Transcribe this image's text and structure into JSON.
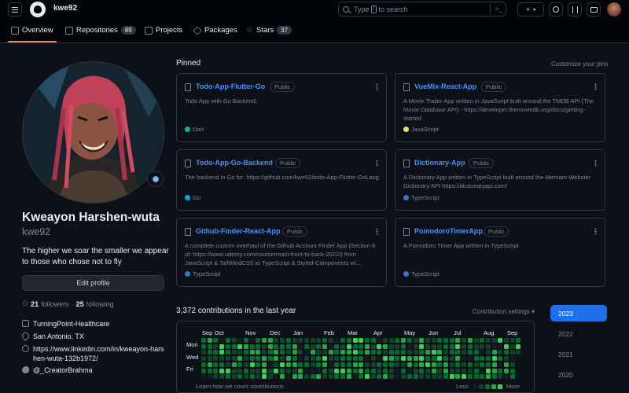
{
  "header": {
    "username": "kwe92",
    "search_prefix": "Type",
    "search_key": "/",
    "search_suffix": "to search",
    "command_glyph": ">_",
    "new_glyph": "+"
  },
  "tabs": [
    {
      "label": "Overview",
      "count": null,
      "active": true
    },
    {
      "label": "Repositories",
      "count": "89"
    },
    {
      "label": "Projects",
      "count": null
    },
    {
      "label": "Packages",
      "count": null
    },
    {
      "label": "Stars",
      "count": "37"
    }
  ],
  "profile": {
    "name": "Kweayon Harshen-wuta",
    "login": "kwe92",
    "bio": "The higher we soar the smaller we appear to those who chose not to fly",
    "edit_label": "Edit profile",
    "followers_count": "21",
    "followers_label": "followers",
    "separator": "·",
    "following_count": "25",
    "following_label": "following",
    "company": "TurningPoint-Healthcare",
    "location": "San Antonio, TX",
    "website": "https://www.linkedin.com/in/kweayon-harshen-wuta-132b1972/",
    "twitter": "@_CreatorBrahma"
  },
  "pinned": {
    "title": "Pinned",
    "customize_label": "Customize your pins",
    "repos": [
      {
        "name": "Todo-App-Flutter-Go",
        "visibility": "Public",
        "description": "Todo App with Go Backend.",
        "language": "Dart",
        "language_color": "#00B4AB"
      },
      {
        "name": "VueMix-React-App",
        "visibility": "Public",
        "description": "A Movie Trailer App written in JavaScript built around the TMDB API (The Movie Database API) - https://developer.themoviedb.org/docs/getting-started",
        "language": "JavaScript",
        "language_color": "#f1e05a"
      },
      {
        "name": "Todo-App-Go-Backend",
        "visibility": "Public",
        "description": "The backend in Go for: https://github.com/kwe92/todo-App-Flutter-GoLang",
        "language": "Go",
        "language_color": "#00ADD8"
      },
      {
        "name": "Dictionary-App",
        "visibility": "Public",
        "description": "A Dictionary App written in TypeScript built around the Merriam-Webster Dictionary API https://dictionaryapi.com/",
        "language": "TypeScript",
        "language_color": "#3178c6"
      },
      {
        "name": "Github-Finder-React-App",
        "visibility": "Public",
        "description": "A complete custom overhaul of the Github Account Finder App (Section 8 of: https://www.udemy.com/course/react-front-to-back-2022/) from JavaScript & TailWindCSS to TypeScript & Styled-Components wi...",
        "language": "TypeScript",
        "language_color": "#3178c6"
      },
      {
        "name": "PomodoroTimerApp",
        "visibility": "Public",
        "description": "A Pomodoro Timer App written in TypeScript",
        "language": "TypeScript",
        "language_color": "#3178c6"
      }
    ]
  },
  "contributions": {
    "title": "3,372 contributions in the last year",
    "settings_label": "Contribution settings ▾",
    "months": [
      "Sep",
      "Oct",
      "Nov",
      "Dec",
      "Jan",
      "Feb",
      "Mar",
      "Apr",
      "May",
      "Jun",
      "Jul",
      "Aug",
      "Sep"
    ],
    "days": [
      "Mon",
      "Wed",
      "Fri"
    ],
    "learn_label": "Learn how we count contributions",
    "less_label": "Less",
    "more_label": "More",
    "level_colors": [
      "#161b22",
      "#0e4429",
      "#006d32",
      "#26a641",
      "#39d353"
    ],
    "years": [
      "2023",
      "2022",
      "2021",
      "2020"
    ],
    "active_year": "2023"
  }
}
